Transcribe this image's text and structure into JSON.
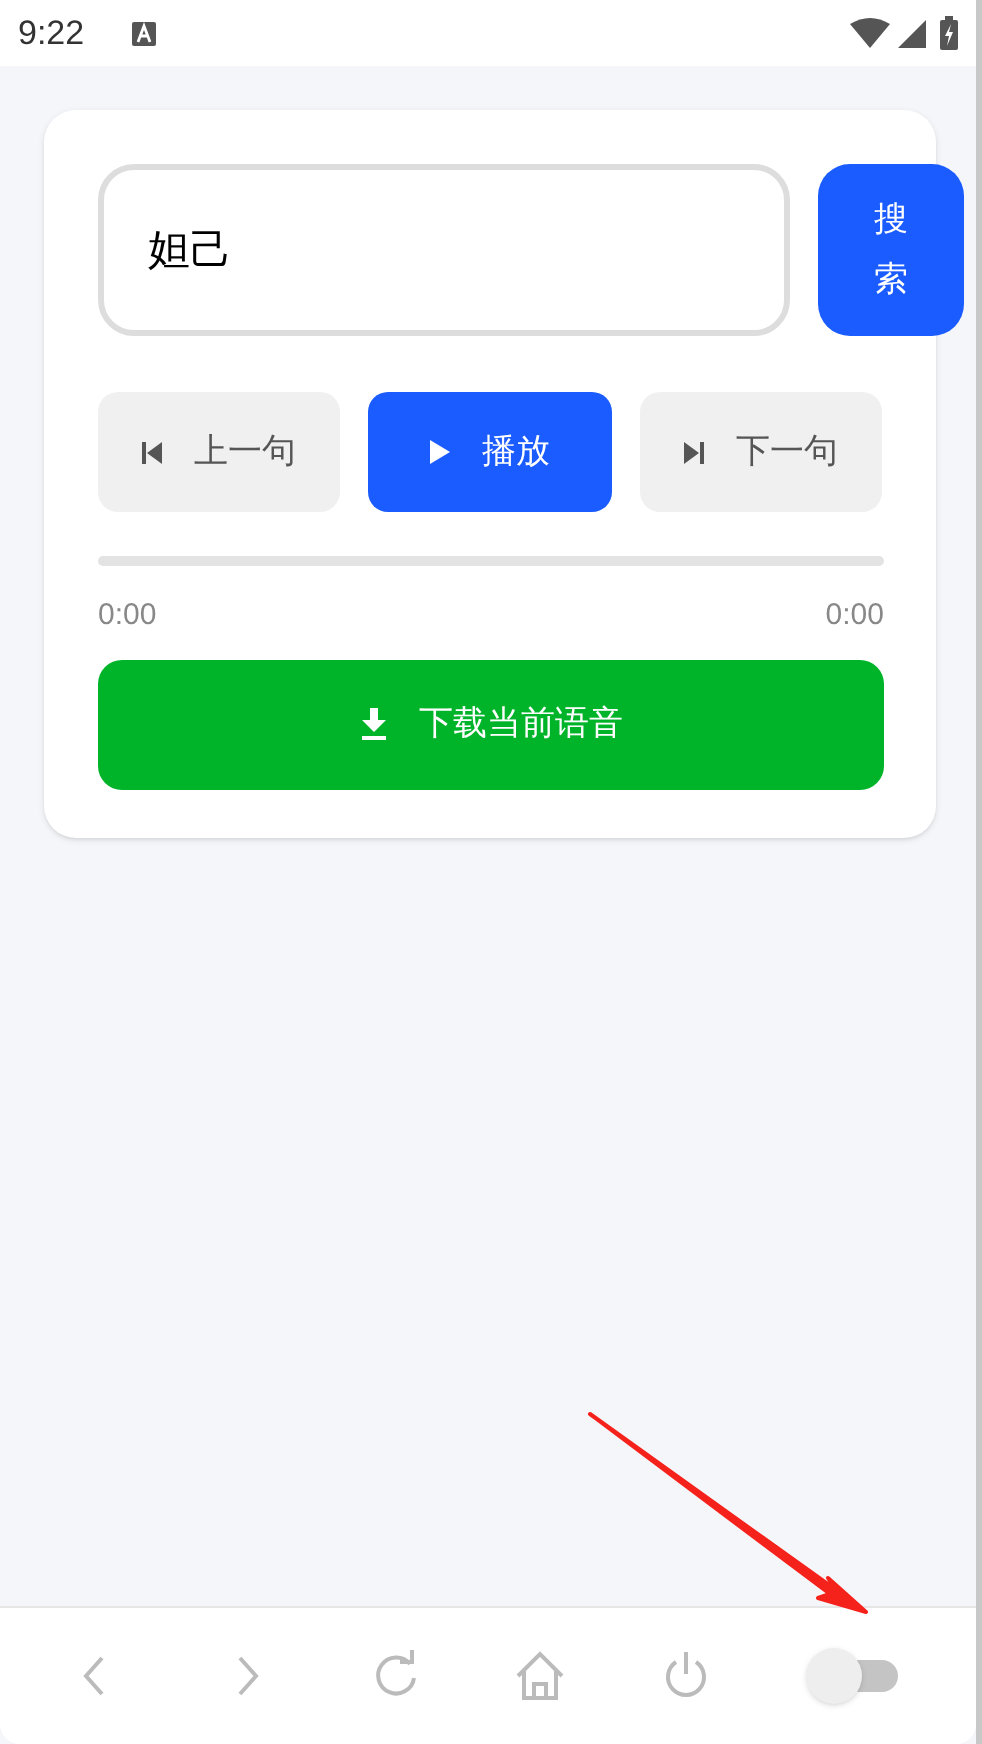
{
  "status_bar": {
    "time": "9:22"
  },
  "search": {
    "value": "妲己",
    "button": "搜索"
  },
  "controls": [
    {
      "kind": "previous",
      "label": "上一句",
      "primary": false
    },
    {
      "kind": "play",
      "label": "播放",
      "primary": true
    },
    {
      "kind": "next",
      "label": "下一句",
      "primary": false
    }
  ],
  "progress": {
    "level": 0,
    "current": "0:00",
    "total": "0:00"
  },
  "download_button": "下载当前语音",
  "nav_bar": {
    "items": [
      {
        "kind": "back"
      },
      {
        "kind": "forward"
      },
      {
        "kind": "reload"
      },
      {
        "kind": "home"
      },
      {
        "kind": "power"
      }
    ],
    "toggle": {
      "on": false
    }
  }
}
